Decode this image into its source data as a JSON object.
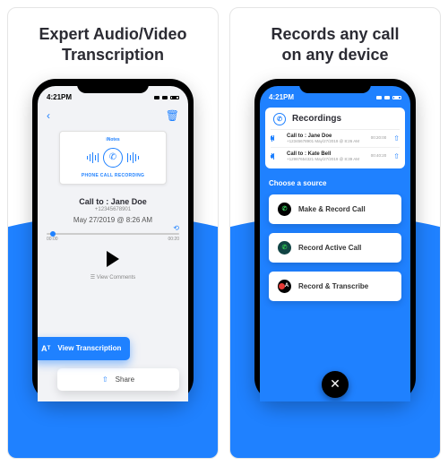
{
  "left": {
    "title_line1": "Expert Audio/Video",
    "title_line2": "Transcription",
    "statusbar_time": "4:21PM",
    "recording_brand": "iNotes",
    "recording_type": "PHONE CALL RECORDING",
    "call_to": "Call to : Jane Doe",
    "call_number": "+12345678901",
    "call_date": "May 27/2019 @ 8:26 AM",
    "progress_start": "00:00",
    "progress_end": "00:20",
    "view_comments": "View Comments",
    "view_transcription": "View Transcription",
    "share": "Share"
  },
  "right": {
    "title_line1": "Records any call",
    "title_line2": "on any device",
    "statusbar_time": "4:21PM",
    "recordings_header": "Recordings",
    "items": [
      {
        "title": "Call to : Jane Doe",
        "sub": "+12345678901   May/27/2019 @ 8:26 AM",
        "dur": "00:20:00"
      },
      {
        "title": "Call to : Kate Bell",
        "sub": "+12987654321   May/27/2019 @ 8:39 AM",
        "dur": "00:40:20"
      }
    ],
    "choose_source": "Choose a source",
    "btn_make": "Make & Record Call",
    "btn_active": "Record Active Call",
    "btn_transcribe": "Record & Transcribe"
  }
}
